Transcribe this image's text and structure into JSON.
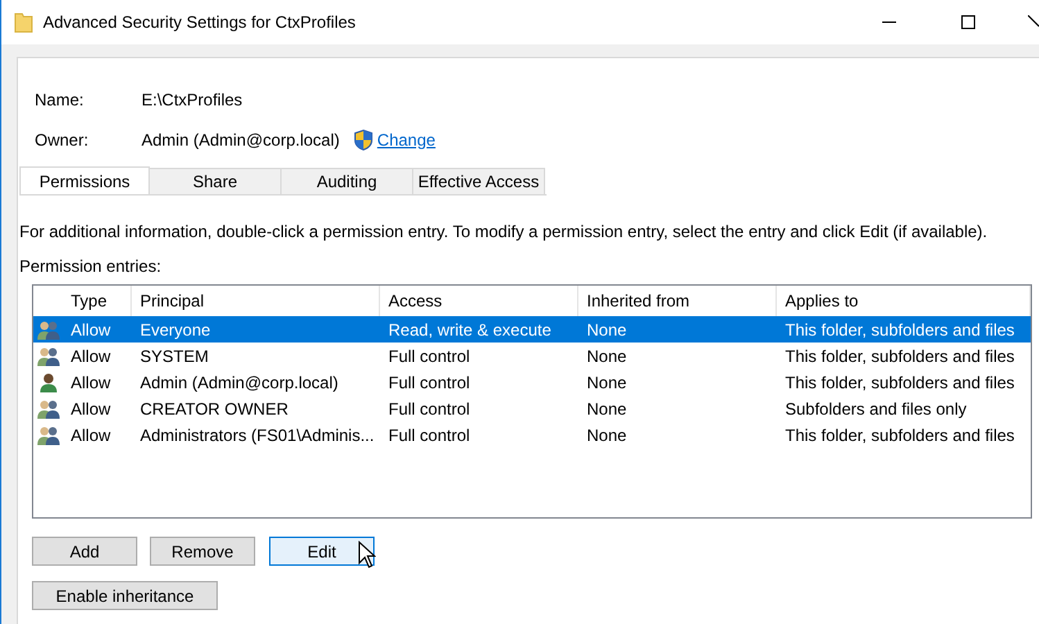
{
  "window": {
    "title": "Advanced Security Settings for CtxProfiles"
  },
  "fields": [
    {
      "label": "Name:",
      "value": "E:\\CtxProfiles"
    },
    {
      "label": "Owner:",
      "value": "Admin (Admin@corp.local)",
      "link": "Change"
    }
  ],
  "tabs": [
    {
      "label": "Permissions",
      "selected": true
    },
    {
      "label": "Share",
      "selected": false
    },
    {
      "label": "Auditing",
      "selected": false
    },
    {
      "label": "Effective Access",
      "selected": false
    }
  ],
  "info": "For additional information, double-click a permission entry. To modify a permission entry, select the entry and click Edit (if available).",
  "entries_label": "Permission entries:",
  "table": {
    "columns": [
      "Type",
      "Principal",
      "Access",
      "Inherited from",
      "Applies to"
    ],
    "rows": [
      {
        "kind": "group",
        "selected": true,
        "cells": [
          "Allow",
          "Everyone",
          "Read, write & execute",
          "None",
          "This folder, subfolders and files"
        ]
      },
      {
        "kind": "group",
        "selected": false,
        "cells": [
          "Allow",
          "SYSTEM",
          "Full control",
          "None",
          "This folder, subfolders and files"
        ]
      },
      {
        "kind": "user",
        "selected": false,
        "cells": [
          "Allow",
          "Admin (Admin@corp.local)",
          "Full control",
          "None",
          "This folder, subfolders and files"
        ]
      },
      {
        "kind": "group",
        "selected": false,
        "cells": [
          "Allow",
          "CREATOR OWNER",
          "Full control",
          "None",
          "Subfolders and files only"
        ]
      },
      {
        "kind": "group",
        "selected": false,
        "cells": [
          "Allow",
          "Administrators (FS01\\Adminis...",
          "Full control",
          "None",
          "This folder, subfolders and files"
        ]
      }
    ]
  },
  "buttons": [
    {
      "label": "Add",
      "hovered": false
    },
    {
      "label": "Remove",
      "hovered": false
    },
    {
      "label": "Edit",
      "hovered": true
    }
  ],
  "inheritance_button": "Enable inheritance"
}
